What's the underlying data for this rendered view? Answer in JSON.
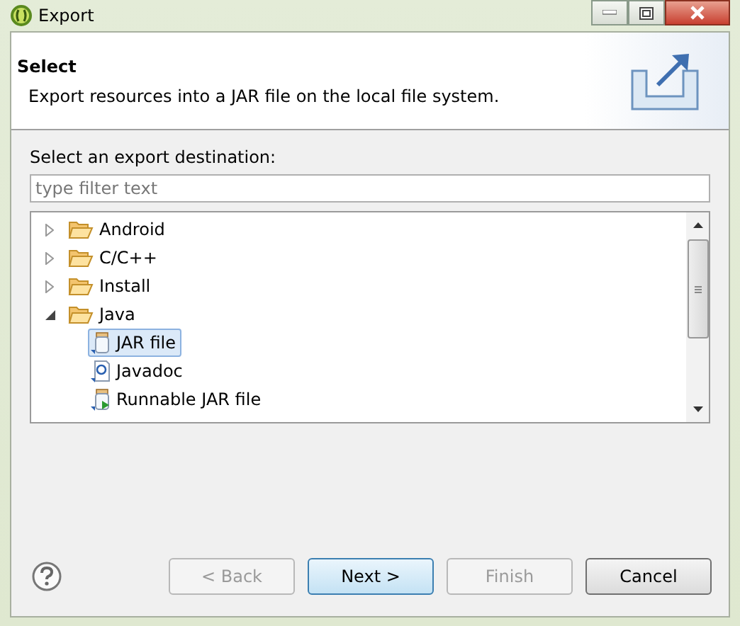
{
  "window": {
    "title": "Export"
  },
  "header": {
    "title": "Select",
    "description": "Export resources into a JAR file on the local file system."
  },
  "destination": {
    "label": "Select an export destination:",
    "placeholder": "type filter text"
  },
  "tree": [
    {
      "label": "Android",
      "kind": "folder",
      "expanded": false,
      "selected": false
    },
    {
      "label": "C/C++",
      "kind": "folder",
      "expanded": false,
      "selected": false
    },
    {
      "label": "Install",
      "kind": "folder",
      "expanded": false,
      "selected": false
    },
    {
      "label": "Java",
      "kind": "folder",
      "expanded": true,
      "selected": false,
      "children": [
        {
          "label": "JAR file",
          "kind": "jar",
          "selected": true
        },
        {
          "label": "Javadoc",
          "kind": "javadoc",
          "selected": false
        },
        {
          "label": "Runnable JAR file",
          "kind": "runnable",
          "selected": false
        }
      ]
    }
  ],
  "buttons": [
    {
      "label": "< Back",
      "disabled": true,
      "default": false
    },
    {
      "label": "Next >",
      "disabled": false,
      "default": true
    },
    {
      "label": "Finish",
      "disabled": true,
      "default": false
    },
    {
      "label": "Cancel",
      "disabled": false,
      "default": false
    }
  ]
}
